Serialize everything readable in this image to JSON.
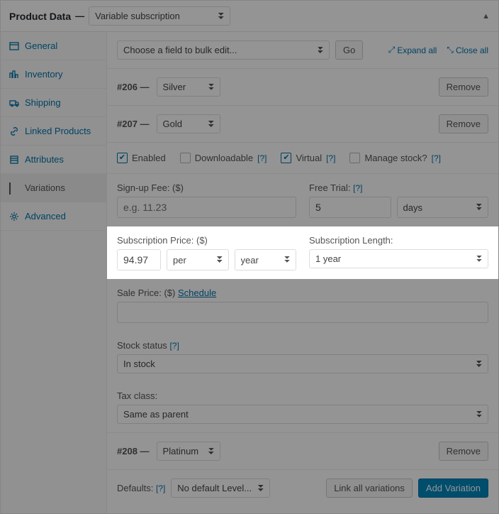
{
  "panel": {
    "title": "Product Data",
    "type_select": "Variable subscription"
  },
  "tabs": [
    {
      "label": "General"
    },
    {
      "label": "Inventory"
    },
    {
      "label": "Shipping"
    },
    {
      "label": "Linked Products"
    },
    {
      "label": "Attributes"
    },
    {
      "label": "Variations"
    },
    {
      "label": "Advanced"
    }
  ],
  "toolbar": {
    "bulk_placeholder": "Choose a field to bulk edit...",
    "go": "Go",
    "expand_all": "Expand all",
    "close_all": "Close all"
  },
  "variations": [
    {
      "id_label": "#206 —",
      "attr": "Silver",
      "remove": "Remove"
    },
    {
      "id_label": "#207 —",
      "attr": "Gold",
      "remove": "Remove",
      "checks": {
        "enabled": {
          "label": "Enabled",
          "checked": true
        },
        "downloadable": {
          "label": "Downloadable",
          "checked": false,
          "help": "[?]"
        },
        "virtual": {
          "label": "Virtual",
          "checked": true,
          "help": "[?]"
        },
        "manage_stock": {
          "label": "Manage stock?",
          "checked": false,
          "help": "[?]"
        }
      },
      "signup_label": "Sign-up Fee: ($)",
      "signup_placeholder": "e.g. 11.23",
      "freetrial_label": "Free Trial:",
      "freetrial_help": "[?]",
      "freetrial_value": "5",
      "freetrial_unit": "days",
      "sub_price_label": "Subscription Price: ($)",
      "sub_price_value": "94.97",
      "sub_price_per": "per",
      "sub_price_unit": "year",
      "sub_len_label": "Subscription Length:",
      "sub_len_value": "1 year",
      "sale_label": "Sale Price: ($)",
      "schedule_link": "Schedule",
      "stock_status_label": "Stock status",
      "stock_status_help": "[?]",
      "stock_status_value": "In stock",
      "tax_label": "Tax class:",
      "tax_value": "Same as parent"
    },
    {
      "id_label": "#208 —",
      "attr": "Platinum",
      "remove": "Remove"
    }
  ],
  "defaults": {
    "label": "Defaults:",
    "help": "[?]",
    "select": "No default Level...",
    "link_all": "Link all variations",
    "add": "Add Variation"
  }
}
